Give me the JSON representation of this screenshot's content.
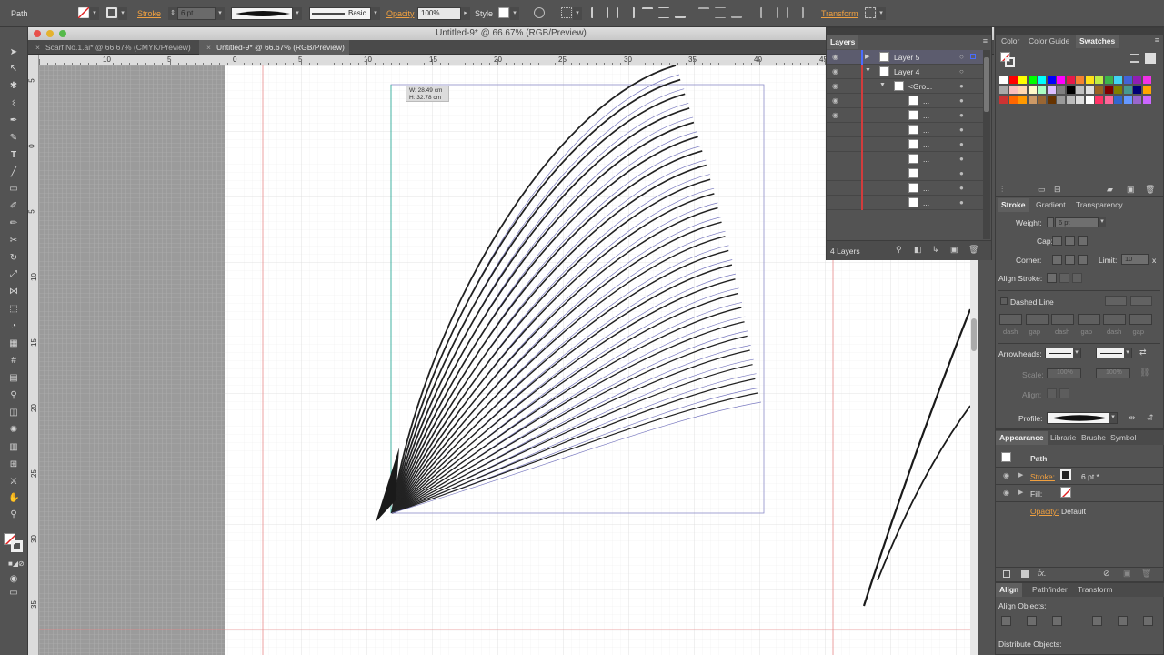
{
  "controlbar": {
    "selection_label": "Path",
    "stroke_label": "Stroke",
    "stroke_weight": "6 pt",
    "brush_label": "Basic",
    "opacity_label": "Opacity",
    "opacity_value": "100%",
    "style_label": "Style",
    "transform_label": "Transform"
  },
  "document": {
    "title": "Untitled-9* @ 66.67% (RGB/Preview)",
    "tabs": [
      {
        "label": "Scarf No.1.ai* @ 66.67% (CMYK/Preview)"
      },
      {
        "label": "Untitled-9* @ 66.67% (RGB/Preview)"
      }
    ],
    "hruler_numbers": [
      "10",
      "5",
      "0",
      "5",
      "10",
      "15",
      "20",
      "25",
      "30",
      "35",
      "40",
      "45"
    ],
    "vruler_numbers": [
      "5",
      "0",
      "5",
      "10",
      "15",
      "20",
      "25",
      "30",
      "35"
    ],
    "tooltip_w": "W: 28.49 cm",
    "tooltip_h": "H: 32.78 cm"
  },
  "layers_panel": {
    "title": "Layers",
    "rows": [
      {
        "name": "Layer 5"
      },
      {
        "name": "Layer 4"
      },
      {
        "name": "<Gro..."
      },
      {
        "name": "..."
      },
      {
        "name": "..."
      },
      {
        "name": "..."
      },
      {
        "name": "..."
      },
      {
        "name": "..."
      },
      {
        "name": "..."
      },
      {
        "name": "..."
      },
      {
        "name": "..."
      }
    ],
    "footer": "4 Layers"
  },
  "swatches_panel": {
    "tabs": [
      "Color",
      "Color Guide",
      "Swatches"
    ],
    "colors": [
      "#ffffff",
      "#ff0000",
      "#ffff00",
      "#00ff00",
      "#00ffff",
      "#0000ff",
      "#ff00ff",
      "#e6194b",
      "#f58231",
      "#ffe119",
      "#bfef45",
      "#3cb44b",
      "#42d4f4",
      "#4363d8",
      "#911eb4",
      "#f032e6",
      "#a9a9a9",
      "#fabebe",
      "#ffd8b1",
      "#fffac8",
      "#aaffc3",
      "#dcbeff",
      "#808080",
      "#000000",
      "#c0c0c0",
      "#e0e0e0",
      "#9a6324",
      "#800000",
      "#808000",
      "#469990",
      "#000075",
      "#ffa500",
      "#cc3333",
      "#ff6600",
      "#ff9900",
      "#cc9966",
      "#996633",
      "#663300",
      "#999999",
      "#bbbbbb",
      "#dddddd",
      "#ffffff",
      "#ff3366",
      "#ff6699",
      "#3366cc",
      "#6699ff",
      "#9966cc",
      "#cc66ff"
    ]
  },
  "stroke_panel": {
    "tabs": [
      "Stroke",
      "Gradient",
      "Transparency"
    ],
    "weight_label": "Weight:",
    "weight_value": "6 pt",
    "cap_label": "Cap:",
    "corner_label": "Corner:",
    "limit_label": "Limit:",
    "limit_value": "10",
    "limit_unit": "x",
    "align_label": "Align Stroke:",
    "dashed_label": "Dashed Line",
    "dash_labels": [
      "dash",
      "gap",
      "dash",
      "gap",
      "dash",
      "gap"
    ],
    "arrowheads_label": "Arrowheads:",
    "scale_label": "Scale:",
    "scale_value_1": "100%",
    "scale_value_2": "100%",
    "align_arrow_label": "Align:",
    "profile_label": "Profile:"
  },
  "appearance_panel": {
    "tabs": [
      "Appearance",
      "Librarie",
      "Brushe",
      "Symbol"
    ],
    "object": "Path",
    "stroke_label": "Stroke:",
    "stroke_value": "6 pt *",
    "fill_label": "Fill:",
    "opacity_label": "Opacity:",
    "opacity_value": "Default"
  },
  "align_panel": {
    "tabs": [
      "Align",
      "Pathfinder",
      "Transform"
    ],
    "align_objects": "Align Objects:",
    "distribute_objects": "Distribute Objects:"
  },
  "colors": {
    "guide": "#e88a8a",
    "selection_box": "#8c8cc8",
    "orange": "#f0a040"
  }
}
